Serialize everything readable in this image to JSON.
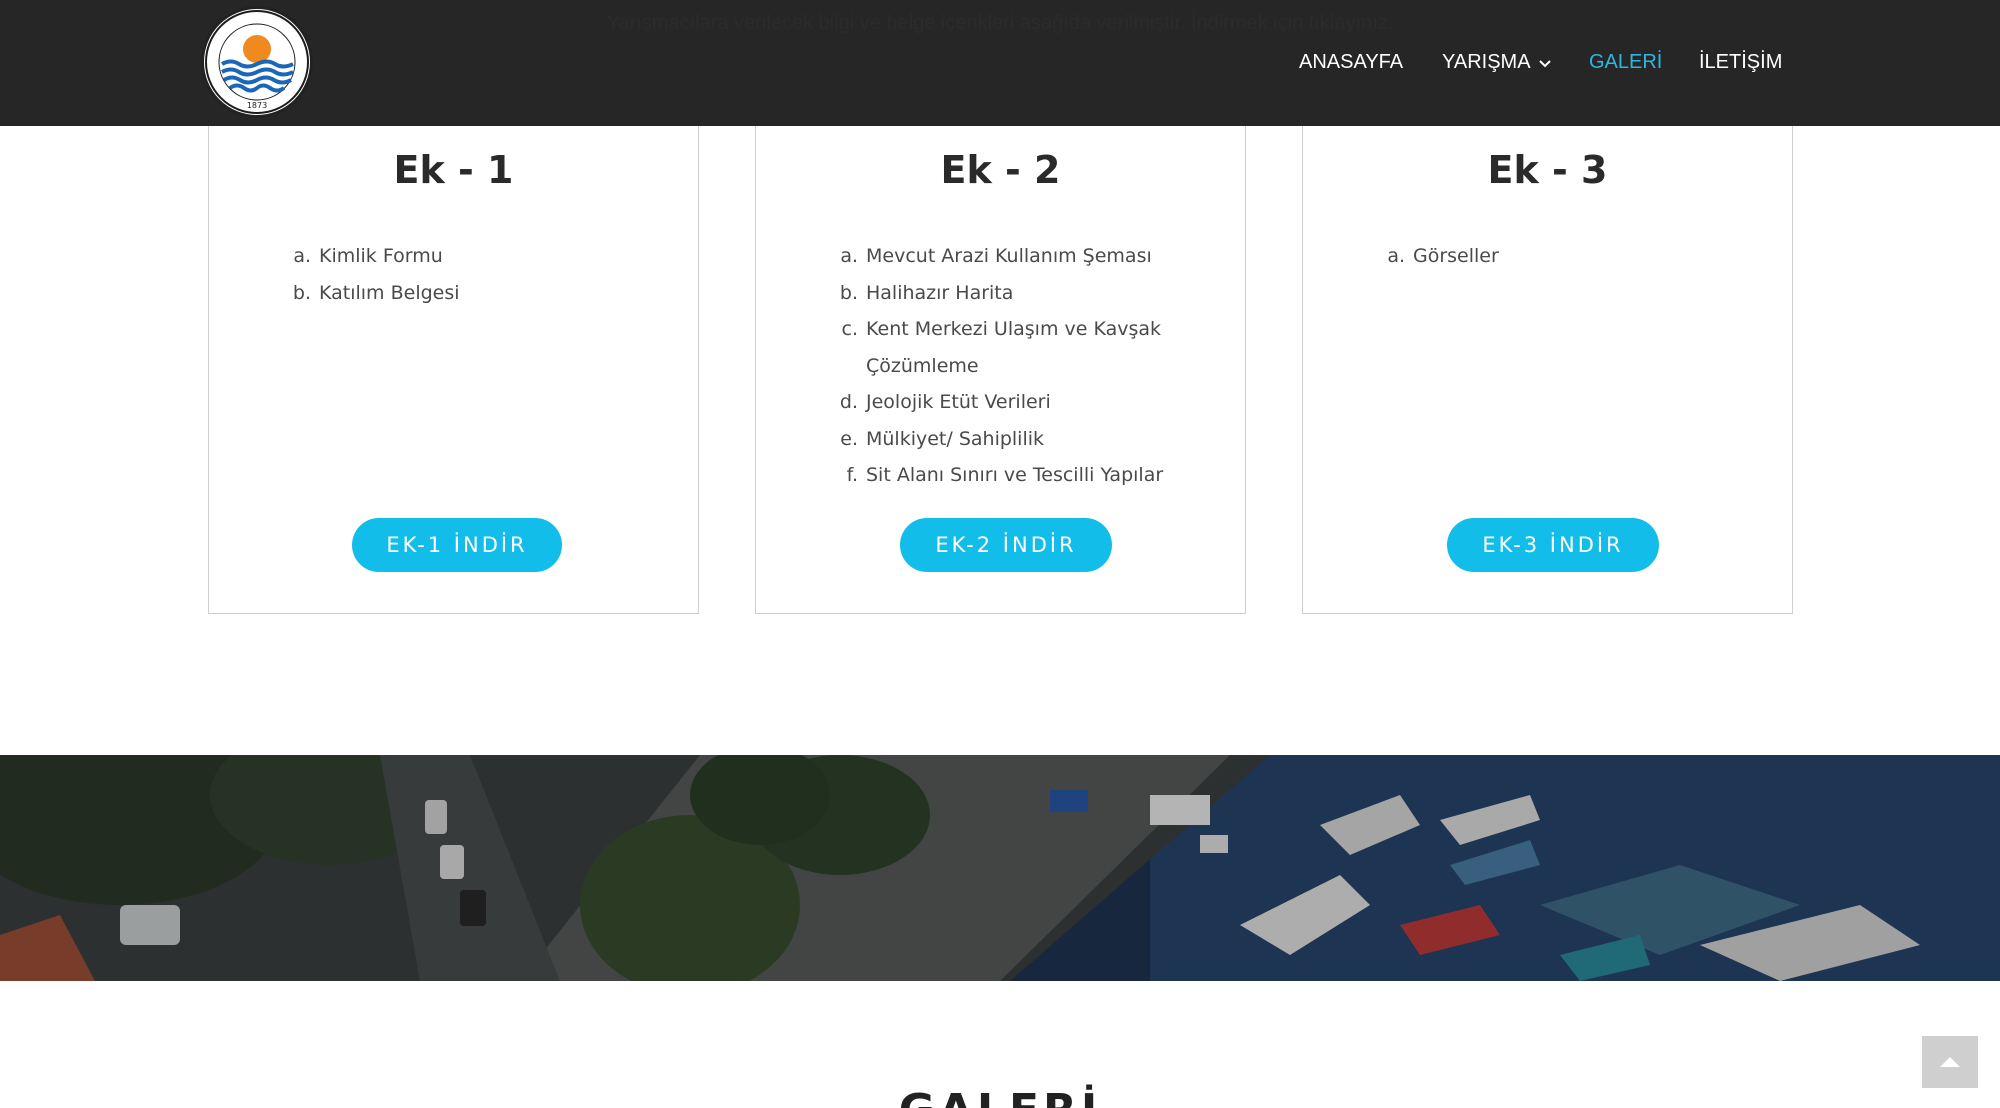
{
  "header": {
    "intro_text": "Yarışmacılara verilecek bilgi ve belge içerikleri aşağıda verilmiştir. İndirmek için tıklayınız.",
    "logo": {
      "icon": "municipality-seal-icon",
      "text_top": "MERSİN BÜYÜKŞEHİR BELEDİYESİ",
      "year": "1873"
    },
    "nav": [
      {
        "label": "ANASAYFA",
        "active": false
      },
      {
        "label": "YARIŞMA",
        "active": false,
        "dropdown": true
      },
      {
        "label": "GALERİ",
        "active": true
      },
      {
        "label": "İLETİŞİM",
        "active": false
      }
    ]
  },
  "cards": [
    {
      "title": "Ek - 1",
      "items": [
        {
          "mark": "a.",
          "text": "Kimlik Formu"
        },
        {
          "mark": "b.",
          "text": "Katılım Belgesi"
        }
      ],
      "button": "EK-1 İNDİR"
    },
    {
      "title": "Ek - 2",
      "items": [
        {
          "mark": "a.",
          "text": "Mevcut Arazi Kullanım Şeması"
        },
        {
          "mark": "b.",
          "text": "Halihazır Harita"
        },
        {
          "mark": "c.",
          "text": "Kent Merkezi Ulaşım ve Kavşak Çözümleme"
        },
        {
          "mark": "d.",
          "text": "Jeolojik Etüt Verileri"
        },
        {
          "mark": "e.",
          "text": "Mülkiyet/ Sahiplilik"
        },
        {
          "mark": "f.",
          "text": "Sit Alanı Sınırı ve Tescilli Yapılar"
        }
      ],
      "button": "EK-2 İNDİR"
    },
    {
      "title": "Ek - 3",
      "items": [
        {
          "mark": "a.",
          "text": "Görseller"
        }
      ],
      "button": "EK-3 İNDİR"
    }
  ],
  "gallery": {
    "title": "GALERİ"
  },
  "colors": {
    "header_bg": "#262626",
    "accent": "#13bde9",
    "nav_active": "#2fb6e0"
  }
}
